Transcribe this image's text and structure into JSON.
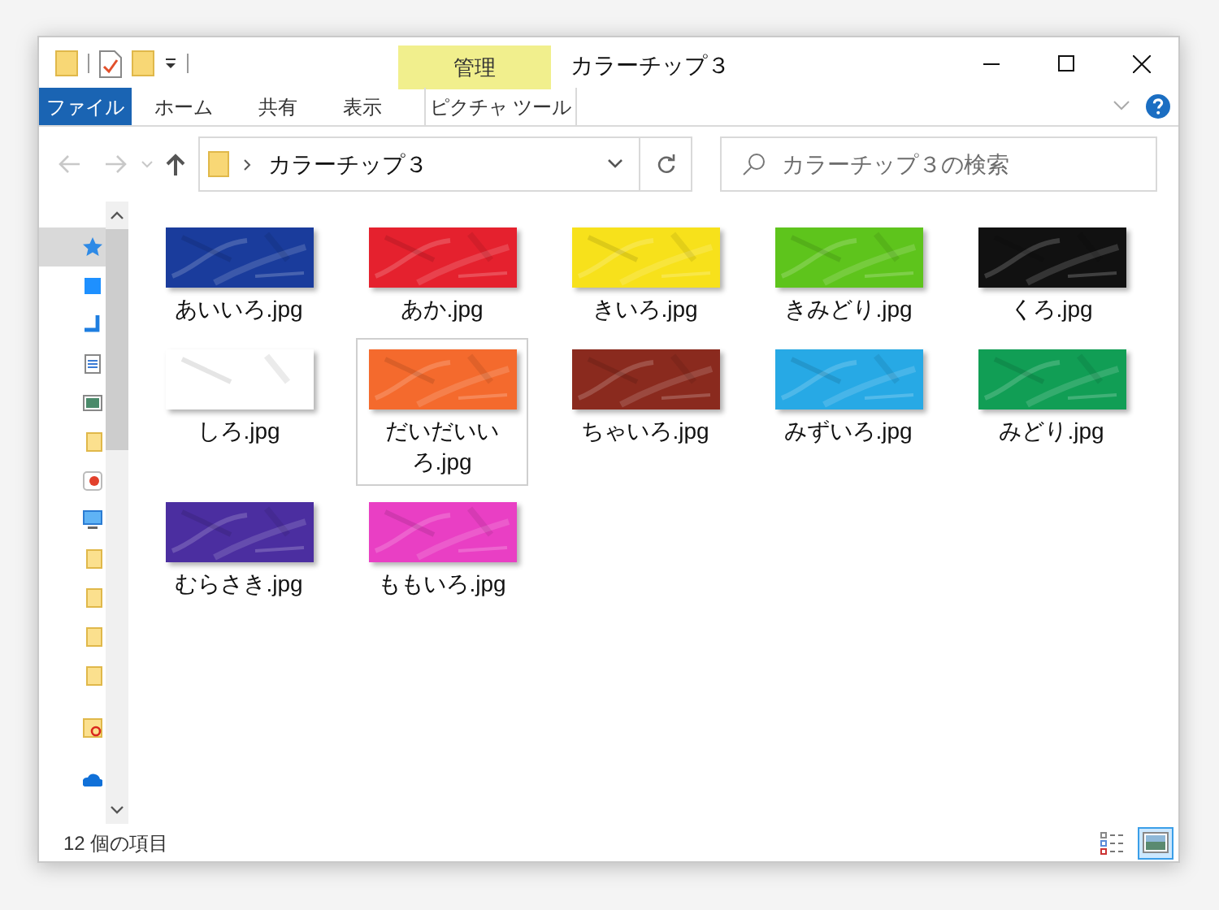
{
  "window": {
    "title": "カラーチップ３"
  },
  "contextual_group": {
    "label": "管理"
  },
  "ribbon_tabs": [
    {
      "label": "ファイル",
      "kind": "file"
    },
    {
      "label": "ホーム",
      "kind": "tab"
    },
    {
      "label": "共有",
      "kind": "tab"
    },
    {
      "label": "表示",
      "kind": "tab"
    },
    {
      "label": "ピクチャ ツール",
      "kind": "contextual"
    }
  ],
  "address": {
    "path": "カラーチップ３"
  },
  "search": {
    "placeholder": "カラーチップ３の検索"
  },
  "nav_pane": {
    "items": [
      {
        "kind": "star",
        "selected": true
      },
      {
        "kind": "desktop",
        "selected": false
      },
      {
        "kind": "download",
        "selected": false
      },
      {
        "kind": "document",
        "selected": false
      },
      {
        "kind": "pictures",
        "selected": false
      },
      {
        "kind": "folder",
        "selected": false
      },
      {
        "kind": "paint",
        "selected": false
      },
      {
        "kind": "pc",
        "selected": false
      },
      {
        "kind": "folder",
        "selected": false
      },
      {
        "kind": "folder",
        "selected": false
      },
      {
        "kind": "folder",
        "selected": false
      },
      {
        "kind": "folder",
        "selected": false
      },
      {
        "kind": "cloud-folder",
        "selected": false
      },
      {
        "kind": "cloud",
        "selected": false
      }
    ]
  },
  "files": [
    {
      "name": "あいいろ.jpg",
      "color": "#1a3c9c",
      "selected": false
    },
    {
      "name": "あか.jpg",
      "color": "#e5212e",
      "selected": false
    },
    {
      "name": "きいろ.jpg",
      "color": "#f7e11b",
      "selected": false
    },
    {
      "name": "きみどり.jpg",
      "color": "#5ec41c",
      "selected": false
    },
    {
      "name": "くろ.jpg",
      "color": "#111111",
      "selected": false
    },
    {
      "name": "しろ.jpg",
      "color": "#ffffff",
      "selected": false
    },
    {
      "name": "だいだいいろ.jpg",
      "color": "#f46a2d",
      "selected": true
    },
    {
      "name": "ちゃいろ.jpg",
      "color": "#8a2a1e",
      "selected": false
    },
    {
      "name": "みずいろ.jpg",
      "color": "#27a9e5",
      "selected": false
    },
    {
      "name": "みどり.jpg",
      "color": "#119e55",
      "selected": false
    },
    {
      "name": "むらさき.jpg",
      "color": "#4b2ea0",
      "selected": false
    },
    {
      "name": "ももいろ.jpg",
      "color": "#e93fc4",
      "selected": false
    }
  ],
  "status_bar": {
    "count": "12 個の項目"
  },
  "views": [
    {
      "kind": "details",
      "selected": false
    },
    {
      "kind": "large_icons",
      "selected": true
    }
  ]
}
